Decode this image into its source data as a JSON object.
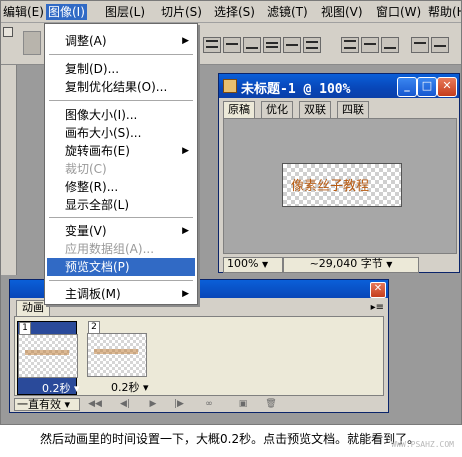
{
  "menubar": {
    "items": [
      "编辑(E)",
      "图像(I)",
      "图层(L)",
      "切片(S)",
      "选择(S)",
      "滤镜(T)",
      "视图(V)",
      "窗口(W)",
      "帮助(H)"
    ],
    "active": "图像(I)"
  },
  "image_menu": {
    "items": [
      {
        "label": "调整(A)",
        "submenu": true,
        "enabled": true
      },
      {
        "label": "复制(D)...",
        "submenu": false,
        "enabled": true
      },
      {
        "label": "复制优化结果(O)...",
        "submenu": false,
        "enabled": true
      },
      {
        "label": "图像大小(I)...",
        "submenu": false,
        "enabled": true
      },
      {
        "label": "画布大小(S)...",
        "submenu": false,
        "enabled": true
      },
      {
        "label": "旋转画布(E)",
        "submenu": true,
        "enabled": true
      },
      {
        "label": "裁切(C)",
        "submenu": false,
        "enabled": false
      },
      {
        "label": "修整(R)...",
        "submenu": false,
        "enabled": true
      },
      {
        "label": "显示全部(L)",
        "submenu": false,
        "enabled": true
      },
      {
        "label": "变量(V)",
        "submenu": true,
        "enabled": true
      },
      {
        "label": "应用数据组(A)...",
        "submenu": false,
        "enabled": false
      },
      {
        "label": "预览文档(P)",
        "submenu": false,
        "enabled": true,
        "highlighted": true
      },
      {
        "label": "主调板(M)",
        "submenu": true,
        "enabled": true
      }
    ]
  },
  "document": {
    "title": "未标题-1 @ 100%",
    "tabs": [
      "原稿",
      "优化",
      "双联",
      "四联"
    ],
    "selected_tab": "原稿",
    "image_text": "像素丝子教程",
    "zoom": "100%",
    "size": "~29,040 字节"
  },
  "animation": {
    "tab": "动画",
    "frames": [
      {
        "num": "1",
        "delay": "0.2秒",
        "selected": true
      },
      {
        "num": "2",
        "delay": "0.2秒",
        "selected": false
      }
    ],
    "loop": "一直有效"
  },
  "caption": "然后动画里的时间设置一下，大概0.2秒。点击预览文档。就能看到了。",
  "watermark": "WWW.PSAHZ.COM",
  "colors": {
    "menu_highlight": "#316ac5",
    "title_bar": "#0a5fd8",
    "workspace": "#9b9b9b"
  }
}
